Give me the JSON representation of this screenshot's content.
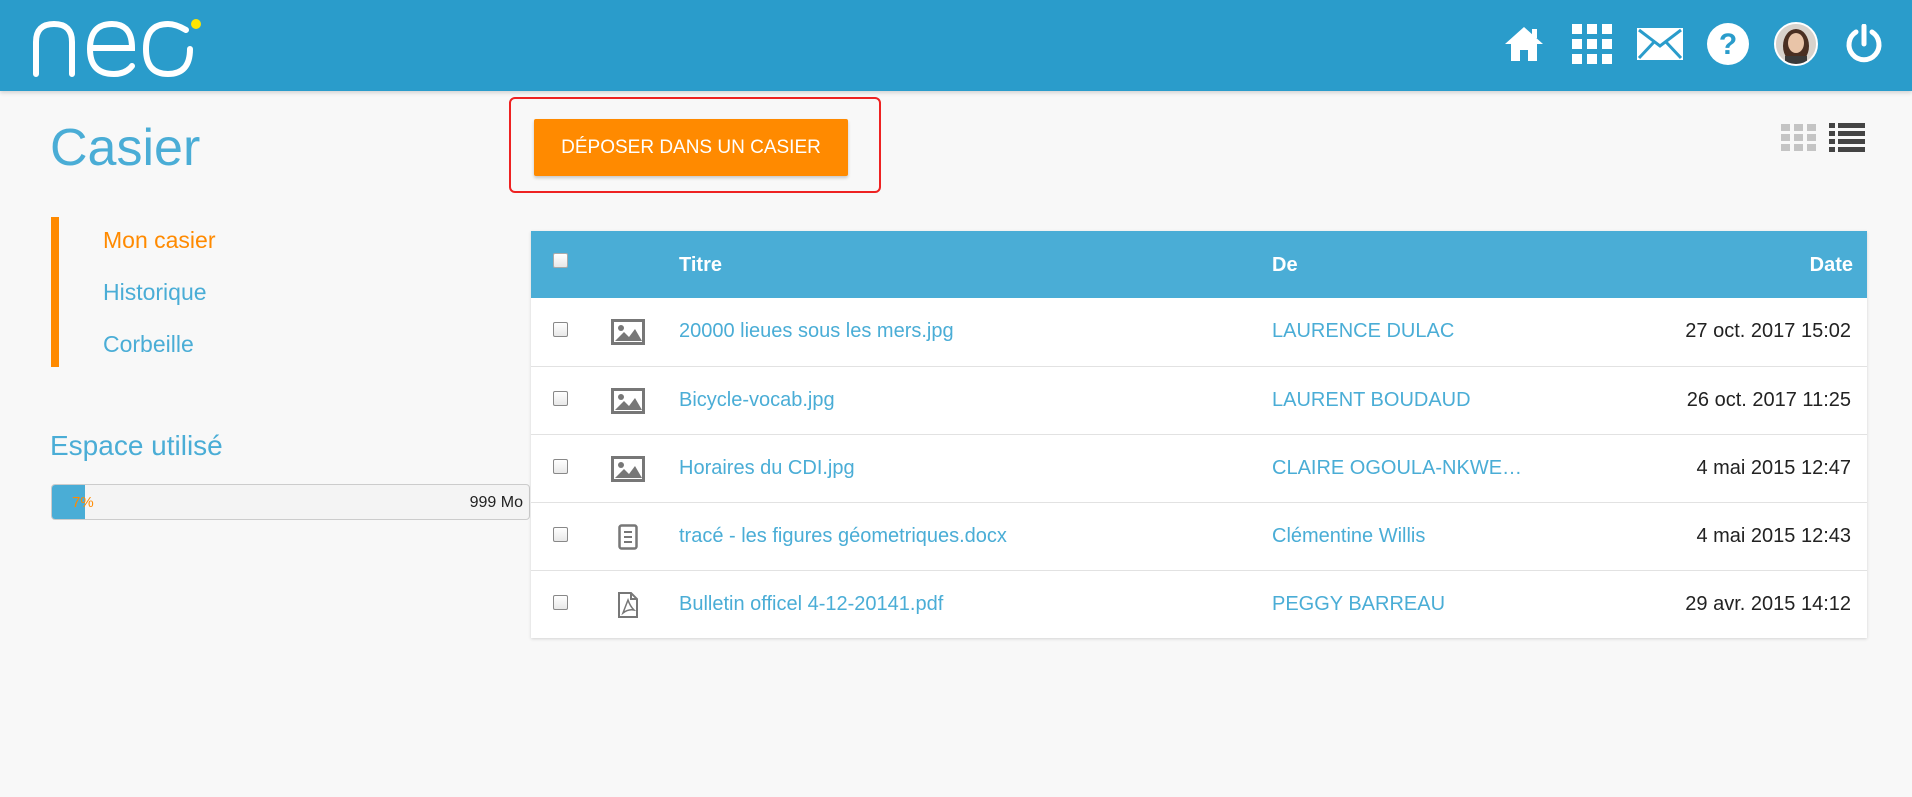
{
  "app": {
    "logo_text": "neo"
  },
  "header_icons": [
    {
      "name": "home-icon",
      "label": "home"
    },
    {
      "name": "apps-grid-icon",
      "label": "apps"
    },
    {
      "name": "mail-icon",
      "label": "mail"
    },
    {
      "name": "help-icon",
      "label": "help"
    },
    {
      "name": "avatar",
      "label": "profile"
    },
    {
      "name": "power-icon",
      "label": "logout"
    }
  ],
  "page": {
    "title": "Casier",
    "deposit_button": "DÉPOSER DANS UN CASIER"
  },
  "sidenav": {
    "items": [
      {
        "label": "Mon casier",
        "active": true
      },
      {
        "label": "Historique",
        "active": false
      },
      {
        "label": "Corbeille",
        "active": false
      }
    ]
  },
  "space": {
    "title": "Espace utilisé",
    "percent_label": "7%",
    "percent": 7,
    "total": "999 Mo"
  },
  "table": {
    "headers": {
      "title": "Titre",
      "from": "De",
      "date": "Date"
    },
    "rows": [
      {
        "icon": "image-icon",
        "title": "20000 lieues sous les mers.jpg",
        "from": "LAURENCE DULAC",
        "date": "27 oct. 2017 15:02"
      },
      {
        "icon": "image-icon",
        "title": "Bicycle-vocab.jpg",
        "from": "LAURENT BOUDAUD",
        "date": "26 oct. 2017 11:25"
      },
      {
        "icon": "image-icon",
        "title": "Horaires du CDI.jpg",
        "from": "CLAIRE OGOULA-NKWEM…",
        "date": "4 mai 2015 12:47"
      },
      {
        "icon": "document-icon",
        "title": "tracé - les figures géometriques.docx",
        "from": "Clémentine Willis",
        "date": "4 mai 2015 12:43"
      },
      {
        "icon": "pdf-icon",
        "title": "Bulletin officel 4-12-20141.pdf",
        "from": "PEGGY BARREAU",
        "date": "29 avr. 2015 14:12"
      }
    ]
  },
  "colors": {
    "header_bg": "#2a9ccb",
    "accent_blue": "#4aadd6",
    "accent_orange": "#ff8a00",
    "highlight_red": "#ee2222"
  }
}
